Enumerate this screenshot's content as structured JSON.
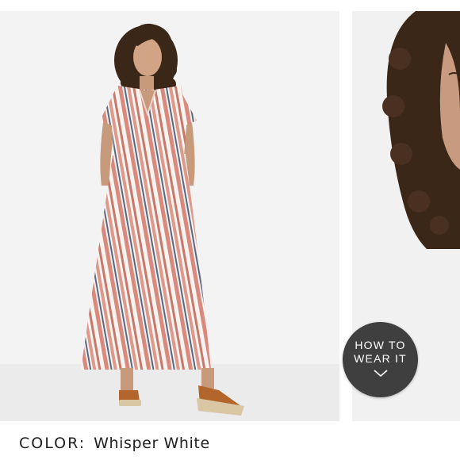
{
  "gallery": {
    "main_image": {
      "alt": "",
      "icon": "model-photo"
    },
    "next_image": {
      "icon": "model-closeup-photo"
    },
    "how_to_wear": {
      "line1": "HOW TO",
      "line2": "WEAR IT",
      "icon": "chevron-down-icon"
    }
  },
  "product": {
    "color_label": "COLOR:",
    "color_value": "Whisper White"
  },
  "colors": {
    "stripe_coral": "#d9897d",
    "stripe_navy": "#5b6780",
    "dress_white": "#f7f3ef",
    "hair": "#3b2718",
    "skin": "#c79a7c",
    "sandal": "#b2662c",
    "button_bg": "#3f3f3f"
  }
}
